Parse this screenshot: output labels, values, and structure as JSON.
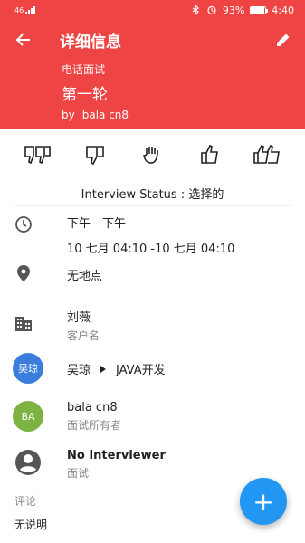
{
  "status_bar": {
    "signal_text": "46",
    "battery_percent": "93%",
    "battery_level": 0.93,
    "time": "4:40"
  },
  "toolbar": {
    "title": "详细信息",
    "back_icon": "arrow-back-icon",
    "edit_icon": "pencil-icon"
  },
  "interview": {
    "type": "电话面试",
    "round": "第一轮",
    "by_label": "by",
    "by_name": "bala cn8",
    "status_label": "Interview Status : 选择的"
  },
  "ratings": [
    {
      "name": "strong-no-icon"
    },
    {
      "name": "no-icon"
    },
    {
      "name": "neutral-icon"
    },
    {
      "name": "yes-icon"
    },
    {
      "name": "strong-yes-icon"
    }
  ],
  "time": {
    "line1": "下午 - 下午",
    "line2": "10 七月 04:10 -10 七月 04:10"
  },
  "location": {
    "text": "无地点"
  },
  "client": {
    "name": "刘薇",
    "label": "客户名"
  },
  "candidate": {
    "avatar_text": "吴琼",
    "avatar_color": "#3b7ddd",
    "name": "吴琼",
    "position": "JAVA开发"
  },
  "owner": {
    "avatar_text": "BA",
    "avatar_color": "#7cb342",
    "name": "bala cn8",
    "label": "面试所有者"
  },
  "interviewer": {
    "name": "No Interviewer",
    "label": "面试"
  },
  "comments": {
    "label": "评论",
    "value": "无说明"
  },
  "fab": {
    "label": "+"
  },
  "colors": {
    "header": "#ef4444",
    "fab": "#2196f3"
  }
}
